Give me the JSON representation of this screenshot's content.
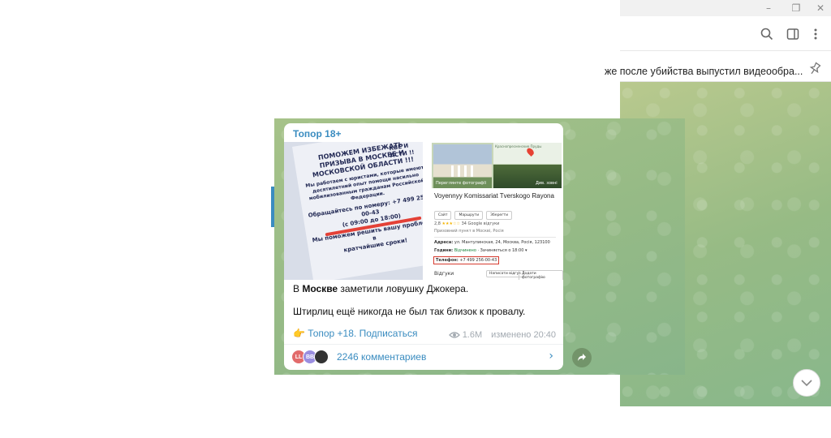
{
  "window": {
    "controls": [
      "–",
      "❐",
      "✕"
    ]
  },
  "header": {
    "icons": [
      "search-icon",
      "sidebar-toggle-icon",
      "more-icon"
    ]
  },
  "pinned": {
    "text": "же после убийства выпустил видеообра..."
  },
  "message": {
    "channel": "Топор 18+",
    "poster_lines": [
      "ПОМОЖЕМ ИЗБЕЖАТЬ",
      "ПРИЗЫВА В МОСКВЕ И",
      "МОСКОВСКОЙ ОБЛАСТИ !!!"
    ],
    "poster_sub": [
      "Мы работаем с юристами, которые имеют",
      "десятилетний опыт помощи насильно",
      "мобилизованным гражданам Российской",
      "Федерации."
    ],
    "poster_phone": [
      "Обращайтесь по номеру: +7 499 256-00-43",
      "(с 09:00 до 18:00)"
    ],
    "poster_bottom": [
      "Мы поможем решить вашу проблему в",
      "кратчайшие сроки!"
    ],
    "poster_top_right": [
      "КВЕ И",
      "АСТИ !!"
    ],
    "map": {
      "photo_caption": "Переглянте фотографії",
      "street_caption": "Див. зовні",
      "place_title": "Voyennyy Komissariat Tverskogo Rayona",
      "chips": [
        "Сайт",
        "Маршрути",
        "Зберегти"
      ],
      "rating": "2,8",
      "stars": "★★★☆☆",
      "reviews_count": "34 Google відгуки",
      "place_type": "Призовний пункт в Москві, Росія",
      "address_label": "Адреса:",
      "address": "ул. Мантулинская, 24, Москва, Росія, 123100",
      "hours_label": "Години:",
      "hours_open": "Відчинено",
      "hours_rest": "· Зачиняється о 18:00 ▾",
      "phone_label": "Телефон:",
      "phone": "+7 499 256-00-43",
      "reviews_label": "Відгуки",
      "write_review": "Написати відгук",
      "add_photo": "Додати фотографію",
      "minimap_label": "Краснопресненские Пруды"
    },
    "text_line1_prefix": "В ",
    "text_line1_bold": "Москве",
    "text_line1_suffix": " заметили ловушку Джокера.",
    "text_line2": "Штирлиц ещё никогда не был так близок к провалу.",
    "subscribe_hand": "👉",
    "subscribe_text": "Топор +18. Подписаться",
    "views": "1.6M",
    "edited": "изменено 20:40",
    "comments": "2246 комментариев",
    "avatars": [
      {
        "initials": "LL",
        "color": "#e26b6b"
      },
      {
        "initials": "BB",
        "color": "#9a8ee0"
      },
      {
        "initials": "",
        "color": "#333333"
      }
    ]
  }
}
